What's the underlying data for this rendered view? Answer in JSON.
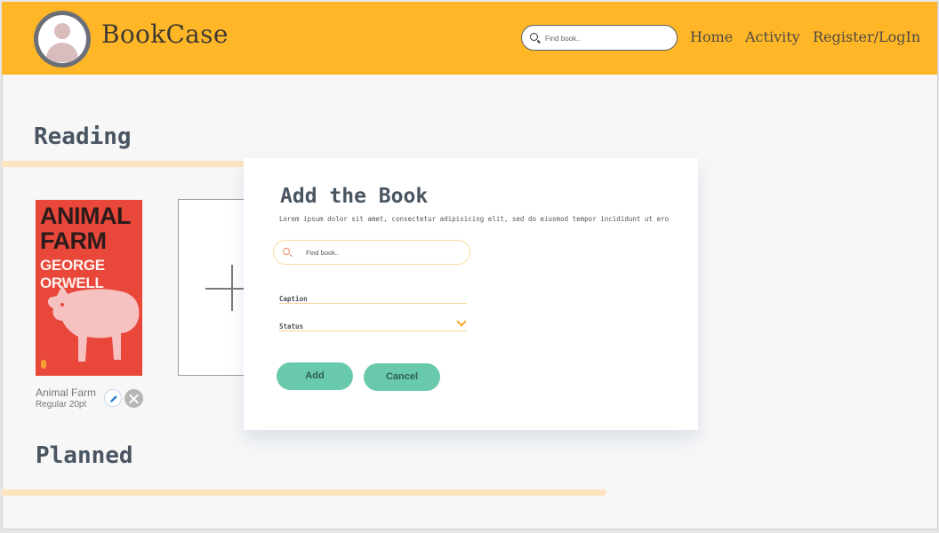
{
  "header": {
    "brand": "BookCase",
    "search_placeholder": "Find book..",
    "nav": [
      "Home",
      "Activity",
      "Register/LogIn"
    ]
  },
  "sections": {
    "reading": "Reading",
    "planned": "Planned"
  },
  "book": {
    "cover_title_line1": "ANIMAL",
    "cover_title_line2": "FARM",
    "cover_author": "GEORGE ORWELL",
    "title": "Animal Farm",
    "subtitle": "Regular 20pt"
  },
  "modal": {
    "title": "Add the Book",
    "description": "Lorem ipsum dolor sit amet, consectetur adipisicing elit, sed do eiusmod tempor incididunt ut ero",
    "search_placeholder": "Find book..",
    "caption_placeholder": "Caption",
    "status_placeholder": "Status",
    "add_label": "Add",
    "cancel_label": "Cancel"
  },
  "colors": {
    "header_bg": "#ffb627",
    "accent_bar": "#fde4be",
    "button": "#68c9ad",
    "heading": "#4a5562"
  }
}
